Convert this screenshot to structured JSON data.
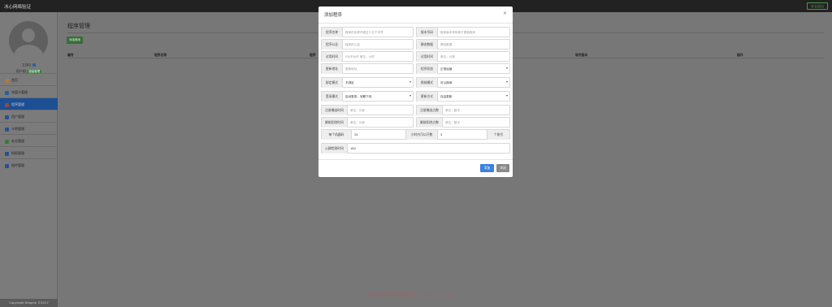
{
  "navbar": {
    "brand": "冰心网络验证",
    "exit_label": "安全退出"
  },
  "sidebar": {
    "username": "1301",
    "role": "用户组",
    "role_badge": "超级管理",
    "copyright": "Copyright Bingxin ©2017",
    "items": [
      {
        "label": "首页",
        "icon": "home-icon",
        "color": "#b07a3a"
      },
      {
        "label": "充值卡管理",
        "icon": "card-icon",
        "color": "#2a5fa0"
      },
      {
        "label": "程序管理",
        "icon": "app-icon",
        "color": "#8a4a4a"
      },
      {
        "label": "用户管理",
        "icon": "user-icon",
        "color": "#2a4f90"
      },
      {
        "label": "卡密管理",
        "icon": "key-icon",
        "color": "#2a4f90"
      },
      {
        "label": "安全管理",
        "icon": "shield-icon",
        "color": "#3a7a3a"
      },
      {
        "label": "授权管理",
        "icon": "auth-icon",
        "color": "#2a4f90"
      },
      {
        "label": "插件管理",
        "icon": "plugin-icon",
        "color": "#2a4f90"
      }
    ]
  },
  "main": {
    "title": "程序管理",
    "add_button": "添加程序",
    "columns": [
      "编号",
      "程序名称",
      "程序",
      "软件版本",
      "操作"
    ]
  },
  "watermark": "专业网站源码下载:源码天堂 www.huzhan.com",
  "modal": {
    "title": "添加程序",
    "close_glyph": "×",
    "fields": {
      "app_name": {
        "label": "程序名称",
        "placeholder": "程序的名称不超过十五个字符"
      },
      "app_version": {
        "label": "版本号码",
        "placeholder": "程序版本号码用于更新程序"
      },
      "app_notice": {
        "label": "程序公告",
        "placeholder": "程序的公告"
      },
      "static_data": {
        "label": "静态数据",
        "placeholder": "静态数据"
      },
      "trial_time": {
        "label": "试用时间",
        "placeholder": "0为不允许 单位：小时"
      },
      "trial_count": {
        "label": "试用时间",
        "placeholder": "单位：分钟"
      },
      "update_url": {
        "label": "更新地址",
        "placeholder": "更新地址"
      },
      "app_status": {
        "label": "程序状态",
        "value": "正常运营"
      },
      "bind_mode": {
        "label": "绑定模式",
        "value": "不绑定"
      },
      "unbind_mode": {
        "label": "换绑模式",
        "value": "可以换绑"
      },
      "login_mode": {
        "label": "登录模式",
        "value": "启动登录、到期下线"
      },
      "charge_mode": {
        "label": "更新方式",
        "value": "自由更新"
      },
      "reg_gift_time": {
        "label": "注册赠送时间",
        "placeholder": "单位：分钟"
      },
      "reg_gift_points": {
        "label": "注册赠送点数",
        "placeholder": "单位：数字"
      },
      "unbind_deduct_time": {
        "label": "解绑扣除时间",
        "placeholder": "单位：分钟"
      },
      "unbind_deduct_points": {
        "label": "解绑扣除点数",
        "placeholder": "单位：数字"
      },
      "interval": {
        "label": "每个机器码",
        "value": "24"
      },
      "max_online": {
        "label": "小时内可以开数",
        "value": "3",
        "suffix": "个账号"
      },
      "heartbeat": {
        "label": "心跳检测时间",
        "value": "180"
      }
    },
    "submit_label": "添加",
    "close_label": "关闭"
  }
}
